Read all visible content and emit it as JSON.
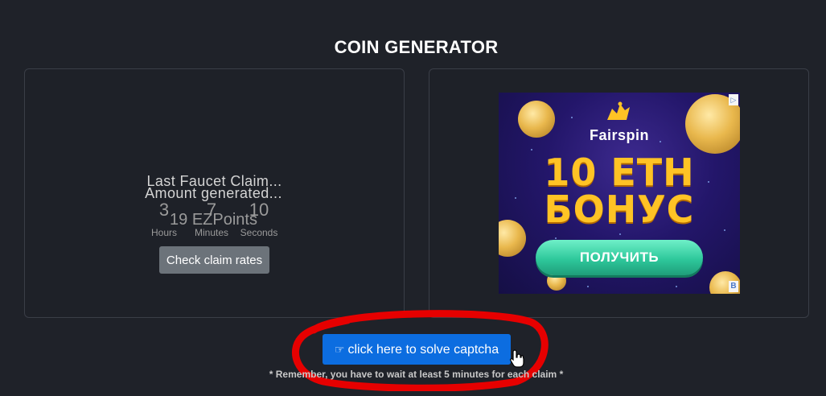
{
  "page": {
    "title": "COIN GENERATOR"
  },
  "claim_card": {
    "heading": "Last Faucet Claim...",
    "timer": [
      {
        "value": "3",
        "label": "Hours"
      },
      {
        "value": "7",
        "label": "Minutes"
      },
      {
        "value": "10",
        "label": "Seconds"
      }
    ],
    "amount_heading": "Amount generated...",
    "amount_value": "19 EZPoints",
    "check_button": "Check claim rates"
  },
  "ad": {
    "brand": "Fairspin",
    "line1": "10 ETH",
    "line2": "БОНУС",
    "cta": "ПОЛУЧИТЬ",
    "badge_b": "B"
  },
  "captcha": {
    "button_label": "click here to solve captcha",
    "icon": "thumbs-up-pointing-icon"
  },
  "footer": {
    "remember": "* Remember, you have to wait at least 5 minutes for each claim *"
  },
  "colors": {
    "background": "#1f2229",
    "card_border": "#3a3e47",
    "primary_button": "#0c6de0",
    "secondary_button": "#6c737a",
    "annotation_red": "#e60000",
    "ad_gold": "#ffc325",
    "ad_green": "#2ec89b"
  }
}
